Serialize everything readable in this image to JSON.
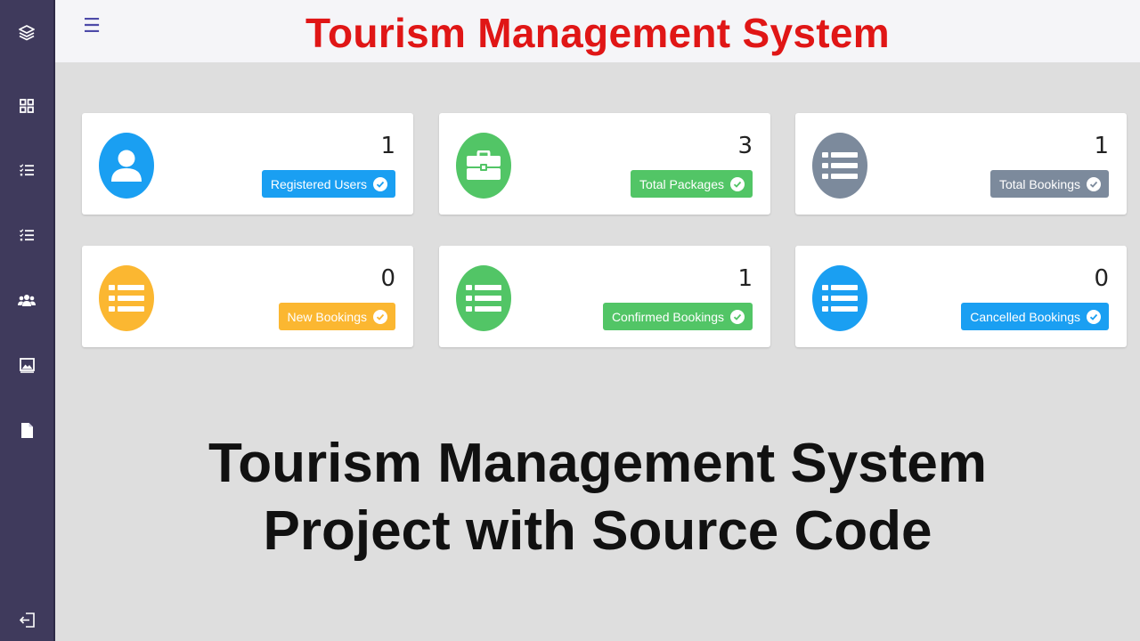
{
  "header": {
    "title": "Tourism Management System",
    "menu_icon": "hamburger-icon"
  },
  "sidebar": {
    "icons": [
      "layers-icon",
      "dashboard-grid-icon",
      "checklist-icon",
      "checklist-icon",
      "users-icon",
      "image-icon",
      "document-icon",
      "logout-icon"
    ]
  },
  "cards": [
    {
      "count": "1",
      "label": "Registered Users",
      "color": "#1a9ff2",
      "icon": "user-icon"
    },
    {
      "count": "3",
      "label": "Total Packages",
      "color": "#52c566",
      "icon": "briefcase-icon"
    },
    {
      "count": "1",
      "label": "Total Bookings",
      "color": "#7c8a9c",
      "icon": "list-icon"
    },
    {
      "count": "0",
      "label": "New Bookings",
      "color": "#fbb731",
      "icon": "list-icon"
    },
    {
      "count": "1",
      "label": "Confirmed Bookings",
      "color": "#52c566",
      "icon": "list-icon"
    },
    {
      "count": "0",
      "label": "Cancelled Bookings",
      "color": "#1a9ff2",
      "icon": "list-icon"
    }
  ],
  "headline": {
    "line1": "Tourism Management System",
    "line2": "Project with Source Code"
  },
  "colors": {
    "sidebar": "#3f3a5c",
    "title": "#e01616",
    "background": "#dedede"
  }
}
